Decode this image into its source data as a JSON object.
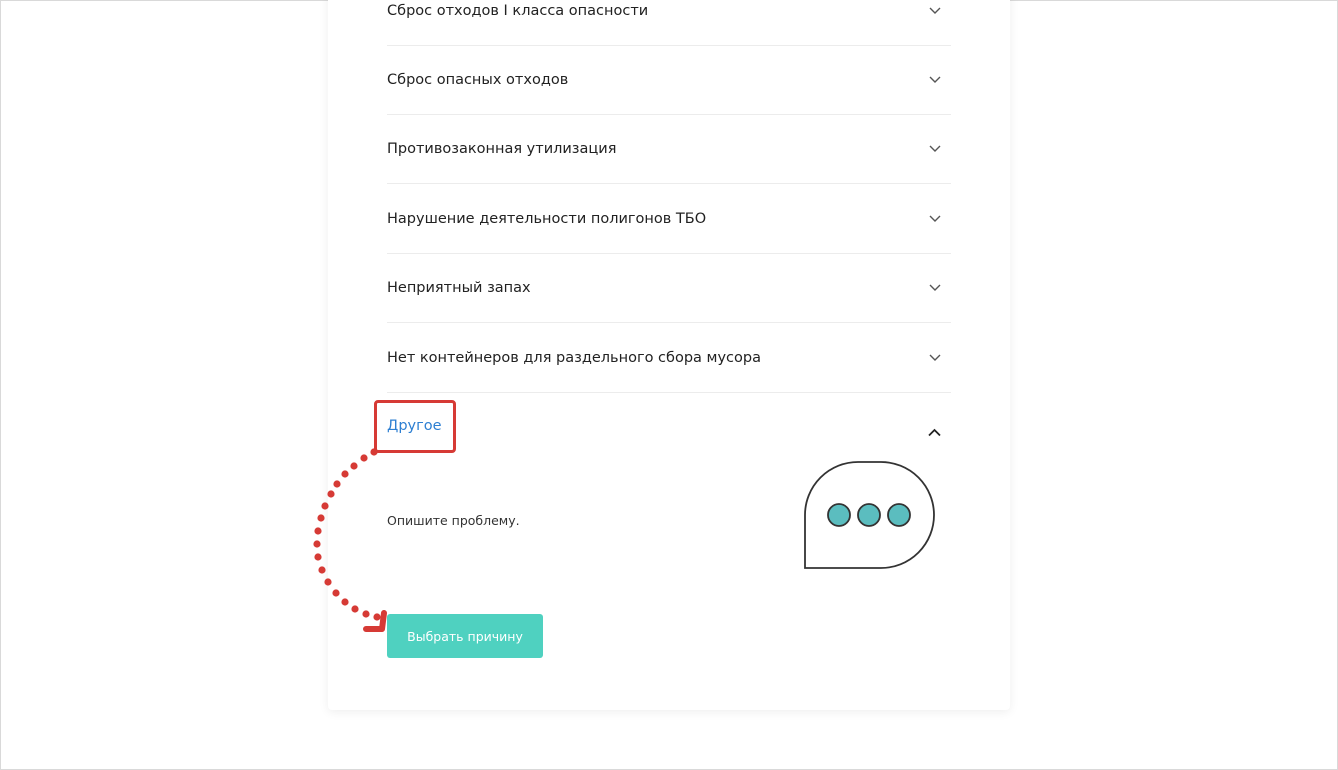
{
  "accordion": {
    "items": [
      {
        "label": "Сброс отходов I класса опасности"
      },
      {
        "label": "Сброс опасных отходов"
      },
      {
        "label": "Противозаконная утилизация"
      },
      {
        "label": "Нарушение деятельности полигонов ТБО"
      },
      {
        "label": "Неприятный запах"
      },
      {
        "label": "Нет контейнеров для раздельного сбора мусора"
      }
    ],
    "open_item": {
      "label": "Другое",
      "description": "Опишите проблему."
    }
  },
  "button": {
    "label": "Выбрать причину"
  },
  "colors": {
    "accent_blue": "#2d7fd2",
    "button_teal": "#4fd1c0",
    "annotation_red": "#d63a35",
    "bubble_dot": "#5bbdbf"
  },
  "icons": {
    "collapsed": "chevron-down-icon",
    "expanded": "chevron-up-icon",
    "illustration": "chat-bubble-icon"
  }
}
